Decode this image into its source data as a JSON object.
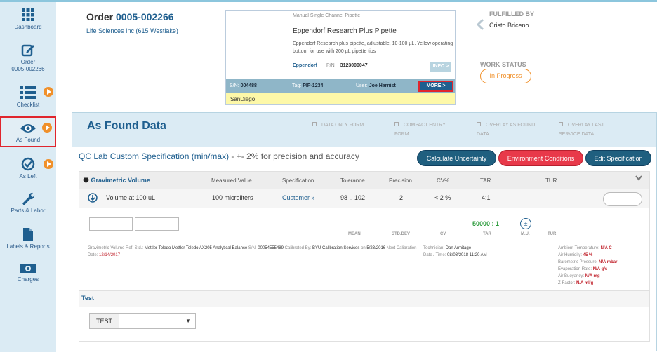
{
  "sidebar": {
    "items": [
      {
        "label": "Dashboard",
        "icon": "grid-icon"
      },
      {
        "label": "Order\n0005-002266",
        "label_line1": "Order",
        "label_line2": "0005-002266",
        "icon": "edit-icon"
      },
      {
        "label": "Checklist",
        "icon": "list-icon"
      },
      {
        "label": "As Found",
        "icon": "eye-icon"
      },
      {
        "label": "As Left",
        "icon": "check-circle-icon"
      },
      {
        "label": "Parts & Labor",
        "icon": "wrench-icon"
      },
      {
        "label": "Labels & Reports",
        "icon": "document-icon"
      },
      {
        "label": "Charges",
        "icon": "money-icon"
      }
    ]
  },
  "order": {
    "title_prefix": "Order",
    "number": "0005-002266",
    "customer": "Life Sciences Inc (615 Westlake)"
  },
  "product": {
    "category": "Manual Single Channel Pipette",
    "name": "Eppendorf Research Plus Pipette",
    "description": "Eppendorf Research plus pipette, adjustable, 10-100 µL. Yellow operating button, for use with 200 µL pipette tips",
    "brand": "Eppendorf",
    "pn_label": "P/N",
    "pn": "3123000047",
    "info_label": "INFO >",
    "sn_label": "S/N:",
    "sn": "004488",
    "tag_label": "Tag:",
    "tag": "PIP-1234",
    "user_label": "User:",
    "user": "Joe Harnist",
    "more_label": "MORE >",
    "location": "SanDiego"
  },
  "fulfilled": {
    "label": "FULFILLED BY",
    "name": "Cristo Briceno"
  },
  "work_status": {
    "label": "WORK STATUS",
    "value": "In Progress"
  },
  "as_found": {
    "title": "As Found Data",
    "options": [
      {
        "line1": "DATA ONLY FORM",
        "line2": ""
      },
      {
        "line1": "COMPACT ENTRY",
        "line2": "FORM"
      },
      {
        "line1": "OVERLAY AS FOUND",
        "line2": "DATA"
      },
      {
        "line1": "OVERLAY LAST",
        "line2": "SERVICE DATA"
      }
    ],
    "spec_title": "QC Lab Custom Specification (min/max)",
    "spec_note": " - +- 2% for precision and accuracy",
    "buttons": {
      "calc": "Calculate Uncertainty",
      "env": "Environment Conditions",
      "edit": "Edit Specification"
    }
  },
  "grid": {
    "section": "Gravimetric Volume",
    "columns": [
      "Measured Value",
      "Specification",
      "Tolerance",
      "Precision",
      "CV%",
      "TAR",
      "TUR"
    ],
    "row": {
      "name": "Volume at 100 uL",
      "measured": "100 microliters",
      "spec": "Customer »",
      "tolerance": "98 .. 102",
      "precision": "2",
      "cv": "< 2 %",
      "tar": "4:1"
    },
    "ratio": "50000 : 1",
    "pm_symbol": "±",
    "stat_labels": [
      "MEAN",
      "STD.DEV",
      "CV",
      "TAR",
      "M.U.",
      "TUR"
    ],
    "ref": {
      "std_label": "Gravimetric Volume Ref. Std.:",
      "std_value": "Mettler Toledo Mettler Toledo AX205 Analytical Balance",
      "sn_label": "S/N:",
      "sn_value": "00054555489",
      "cal_by_label": "Calibrated By:",
      "cal_by_value": "BYU Calibration",
      "services_value": "Services",
      "on_label": "on",
      "on_value": "5/23/2016",
      "next_label": "Next Calibration Date:",
      "next_value": "12/14/2017"
    },
    "tech": {
      "tech_label": "Technician:",
      "tech_value": "Dan Armitage",
      "dt_label": "Date / Time:",
      "dt_value": "08/03/2018 11:20 AM"
    },
    "env": [
      {
        "label": "Ambient Temperature:",
        "value": "N/A C"
      },
      {
        "label": "Air Humidity:",
        "value": "45 %"
      },
      {
        "label": "Barometric Pressure:",
        "value": "N/A mbar"
      },
      {
        "label": "Evaporation Rate:",
        "value": "N/A g/s"
      },
      {
        "label": "Air Buoyancy:",
        "value": "N/A mg"
      },
      {
        "label": "Z-Factor:",
        "value": "N/A ml/g"
      }
    ],
    "test_header": "Test",
    "test_label": "TEST",
    "test_caret": "▼"
  },
  "colors": {
    "accent": "#1f5f8f",
    "warning": "#f0902a",
    "danger": "#e8394a",
    "success": "#2a9a3a"
  }
}
